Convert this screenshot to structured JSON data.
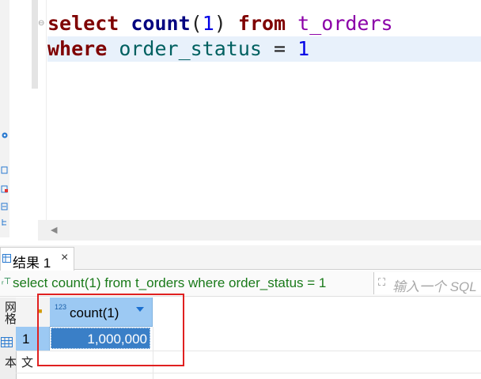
{
  "editor": {
    "line1": {
      "kw_select": "select",
      "fn_count": "count",
      "paren_open": "(",
      "num": "1",
      "paren_close": ")",
      "kw_from": "from",
      "table": "t_orders"
    },
    "line2": {
      "kw_where": "where",
      "column": "order_status",
      "op": "=",
      "num": "1"
    }
  },
  "results": {
    "tab_label": "结果 1",
    "tab_close": "×",
    "query_text": "select count(1) from t_orders where order_status = 1",
    "filter_placeholder": "输入一个 SQL",
    "side_label_top": "网格",
    "side_label_bottom": "文本",
    "column": {
      "type_badge": "123",
      "name": "count(1)"
    },
    "rows": [
      {
        "num": "1",
        "value": "1,000,000"
      }
    ]
  },
  "colors": {
    "highlight": "#e02020",
    "selected_cell": "#3a7fc7",
    "header": "#9cc9f3"
  }
}
